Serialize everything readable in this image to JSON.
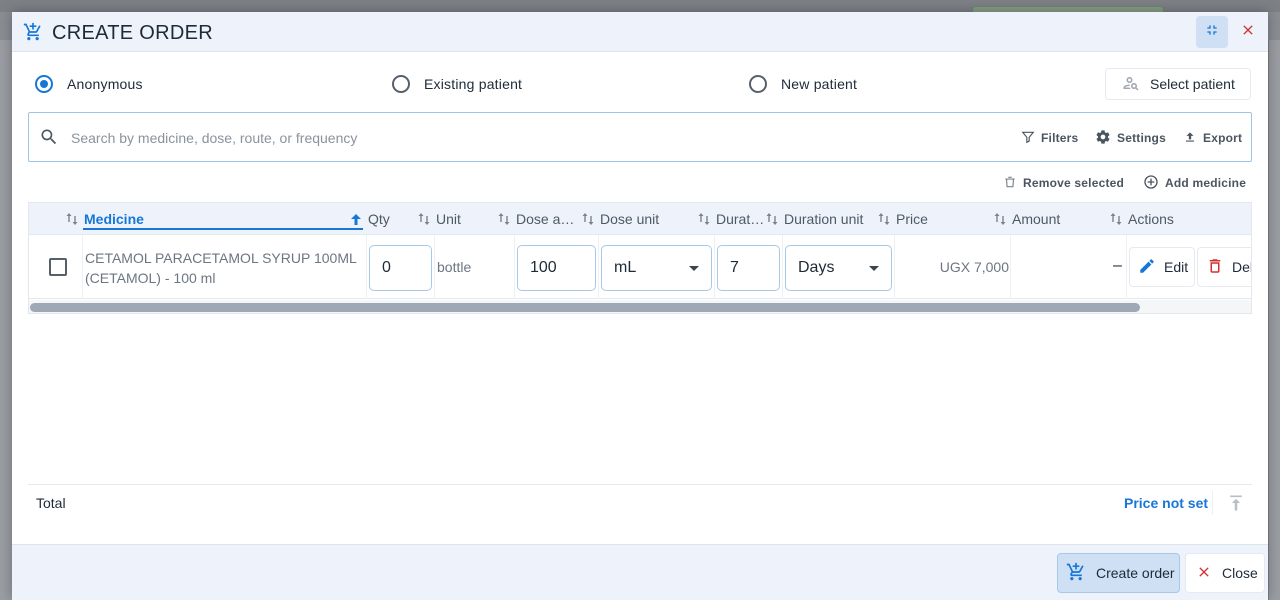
{
  "dialog": {
    "title": "CREATE ORDER",
    "title_icon": "cart-plus-icon",
    "minimize_icon": "fullscreen-exit-icon",
    "close_icon": "close-icon"
  },
  "patient_mode": {
    "options": [
      {
        "label": "Anonymous",
        "selected": true
      },
      {
        "label": "Existing patient",
        "selected": false
      },
      {
        "label": "New patient",
        "selected": false
      }
    ],
    "select_patient_label": "Select patient"
  },
  "search": {
    "placeholder": "Search by medicine, dose, route, or frequency",
    "value": "",
    "filters_label": "Filters",
    "settings_label": "Settings",
    "export_label": "Export"
  },
  "actions": {
    "remove_selected_label": "Remove selected",
    "add_medicine_label": "Add medicine"
  },
  "table": {
    "columns": [
      "Medicine",
      "Qty",
      "Unit",
      "Dose a…",
      "Dose unit",
      "Durat…",
      "Duration unit",
      "Price",
      "Amount",
      "Actions"
    ],
    "sorted_column": "Medicine",
    "rows": [
      {
        "medicine": "CETAMOL PARACETAMOL SYRUP 100ML (CETAMOL) - 100 ml",
        "qty": "0",
        "unit": "bottle",
        "dose_amount": "100",
        "dose_unit": "mL",
        "duration": "7",
        "duration_unit": "Days",
        "price": "UGX 7,000",
        "amount": "–",
        "edit_label": "Edit",
        "delete_label": "Del"
      }
    ],
    "scroll_fraction": 0.91
  },
  "totals": {
    "label": "Total",
    "value": "Price not set"
  },
  "footer": {
    "create_label": "Create order",
    "close_label": "Close"
  },
  "colors": {
    "accent": "#1677d6",
    "header_bg": "#eef3fb",
    "danger": "#d32f2f"
  }
}
